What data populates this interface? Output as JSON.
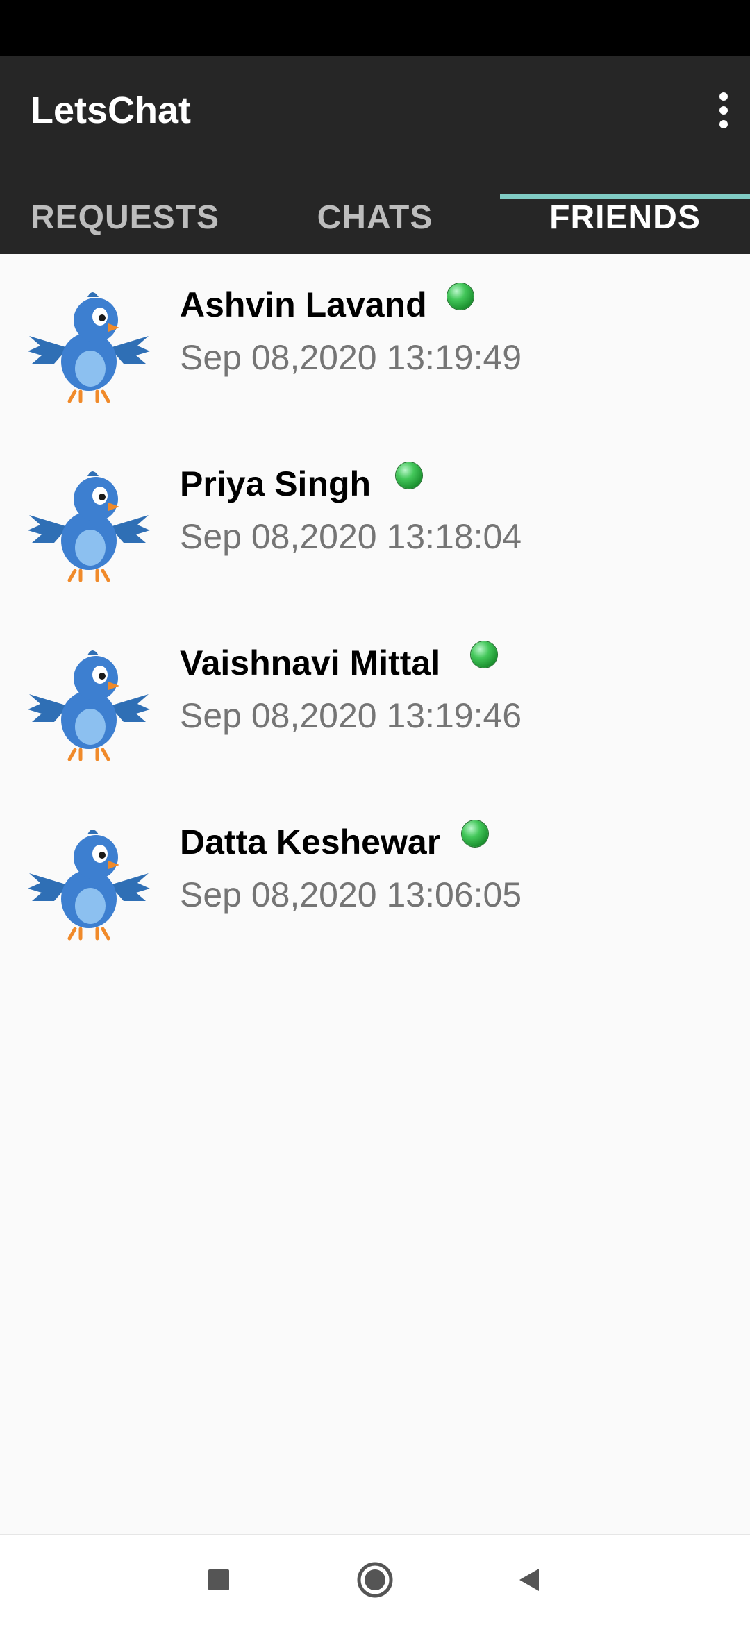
{
  "app": {
    "title": "LetsChat"
  },
  "tabs": [
    {
      "label": "REQUESTS",
      "active": false
    },
    {
      "label": "CHATS",
      "active": false
    },
    {
      "label": "FRIENDS",
      "active": true
    }
  ],
  "friends": [
    {
      "name": "Ashvin Lavand",
      "last_seen": "Sep 08,2020 13:19:49",
      "online": true
    },
    {
      "name": "Priya Singh",
      "last_seen": "Sep 08,2020 13:18:04",
      "online": true
    },
    {
      "name": "Vaishnavi Mittal",
      "last_seen": "Sep 08,2020 13:19:46",
      "online": true
    },
    {
      "name": "Datta Keshewar",
      "last_seen": "Sep 08,2020 13:06:05",
      "online": true
    }
  ],
  "icons": {
    "overflow": "more-vert-icon",
    "avatar": "blue-bird-avatar",
    "online": "online-status-icon",
    "nav_recents": "square-icon",
    "nav_home": "circle-icon",
    "nav_back": "triangle-back-icon"
  },
  "colors": {
    "app_bar": "#262626",
    "tab_indicator": "#80cbc4",
    "online": "#43c75a",
    "background": "#fafafa"
  }
}
